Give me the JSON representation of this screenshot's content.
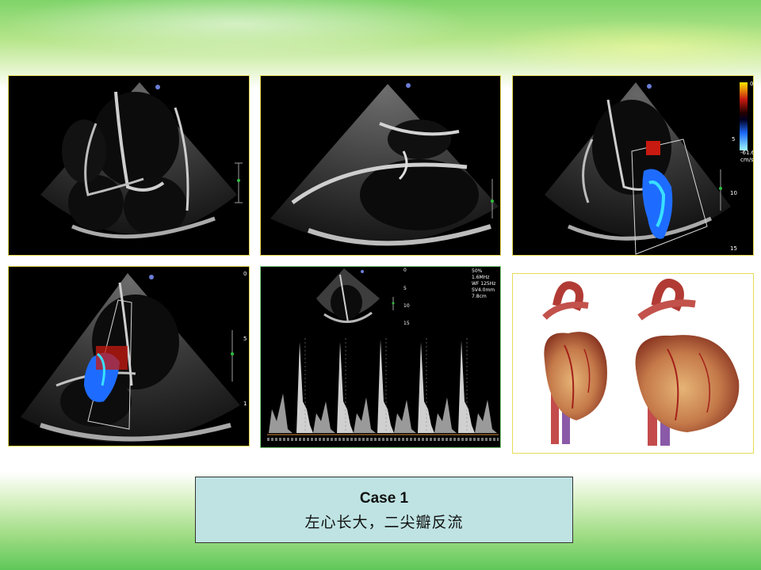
{
  "caption": {
    "title": "Case 1",
    "subtitle": "左心长大，二尖瓣反流"
  },
  "panels": {
    "p3": {
      "scale_top": "0",
      "scale_bottom": "-61.6",
      "scale_unit": "cm/s",
      "depth_5": "5",
      "depth_10": "10",
      "depth_15": "15"
    },
    "p4": {
      "depth_0": "0",
      "depth_5": "5",
      "depth_10": "1"
    },
    "p5": {
      "depth_0": "0",
      "depth_5": "5",
      "depth_10": "10",
      "depth_15": "15",
      "param_1": "50%",
      "param_2": "1.6MHz",
      "param_3": "WF 125Hz",
      "param_4": "SV4.0mm",
      "param_5": "7.8cm"
    }
  },
  "colors": {
    "accent_border": "#e4d84a",
    "caption_bg": "#bfe3e3",
    "doppler_blue": "#1e6cff",
    "doppler_red": "#c81a10"
  }
}
